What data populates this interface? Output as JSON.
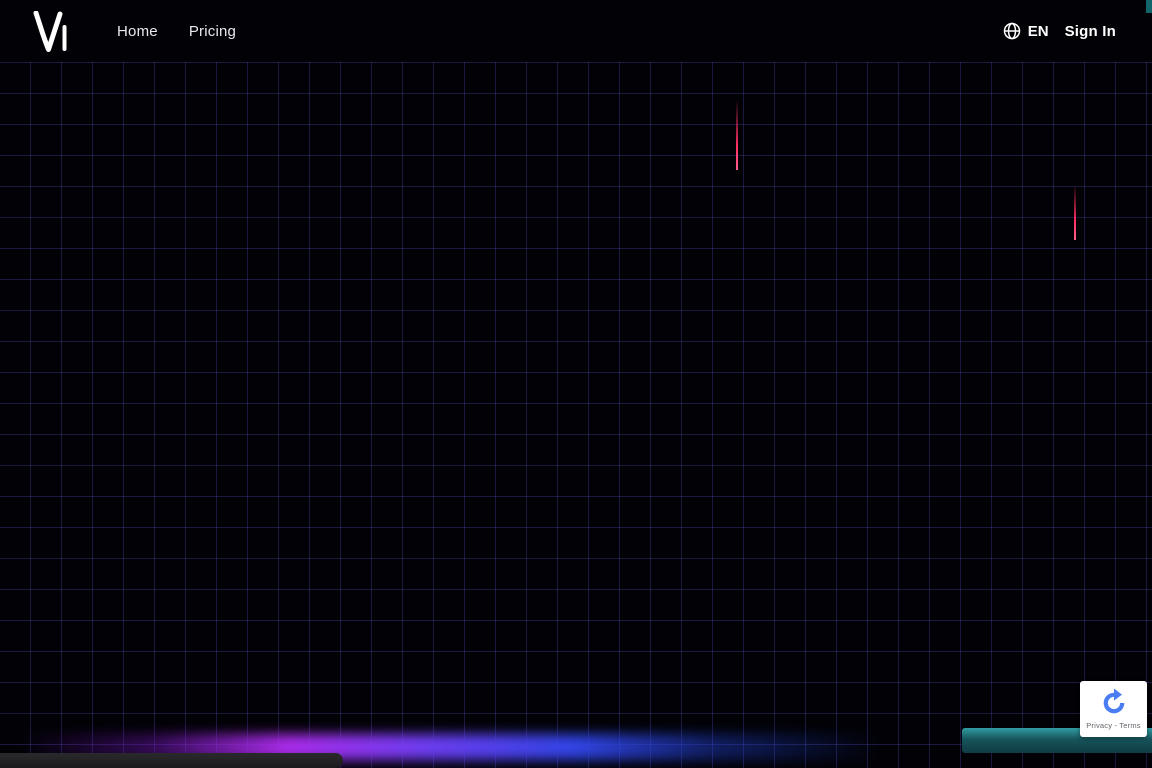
{
  "header": {
    "nav_items": [
      {
        "label": "Home"
      },
      {
        "label": "Pricing"
      }
    ],
    "language_code": "EN",
    "sign_in_label": "Sign In"
  },
  "recaptcha": {
    "links_label": "Privacy - Terms"
  },
  "icons": {
    "logo": "brand-v-logo",
    "globe": "globe-icon",
    "recaptcha": "recaptcha-swirl-icon"
  },
  "colors": {
    "background": "#020206",
    "grid_line": "#23234f",
    "beam_pink": "#ff2e63",
    "glow_purple": "#a92be8",
    "glow_blue": "#3044e4",
    "teal_bar": "#17545b",
    "bottom_bar": "#232325",
    "recaptcha_blue": "#4a7df2",
    "nav_text": "#e9e9ee"
  }
}
